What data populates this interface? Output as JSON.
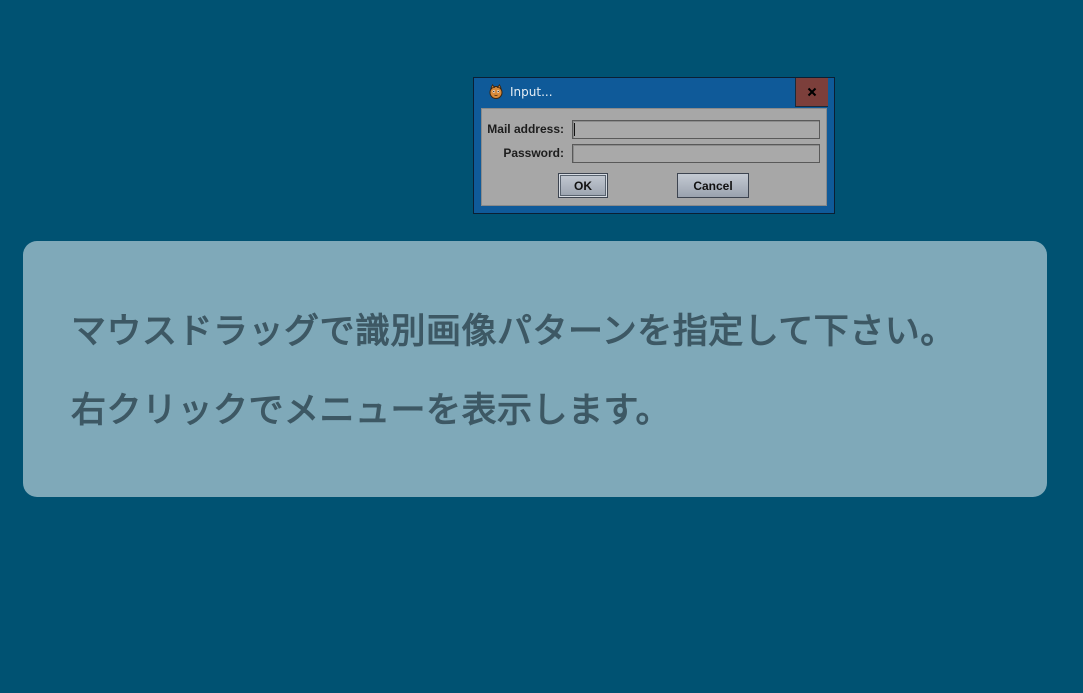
{
  "dialog": {
    "title": "Input...",
    "icon": "app-cat-icon",
    "close_icon": "close-icon",
    "fields": {
      "mail_label": "Mail address:",
      "mail_value": "",
      "password_label": "Password:",
      "password_value": ""
    },
    "buttons": {
      "ok_label": "OK",
      "cancel_label": "Cancel"
    }
  },
  "info": {
    "line1": "マウスドラッグで識別画像パターンを指定して下さい。",
    "line2": "右クリックでメニューを表示します。"
  },
  "colors": {
    "desktop_background": "#005272",
    "titlebar": "#0f5a99",
    "close_button": "#7c3f3b",
    "info_panel": "#7fa9b9",
    "info_text": "#3d5864"
  }
}
